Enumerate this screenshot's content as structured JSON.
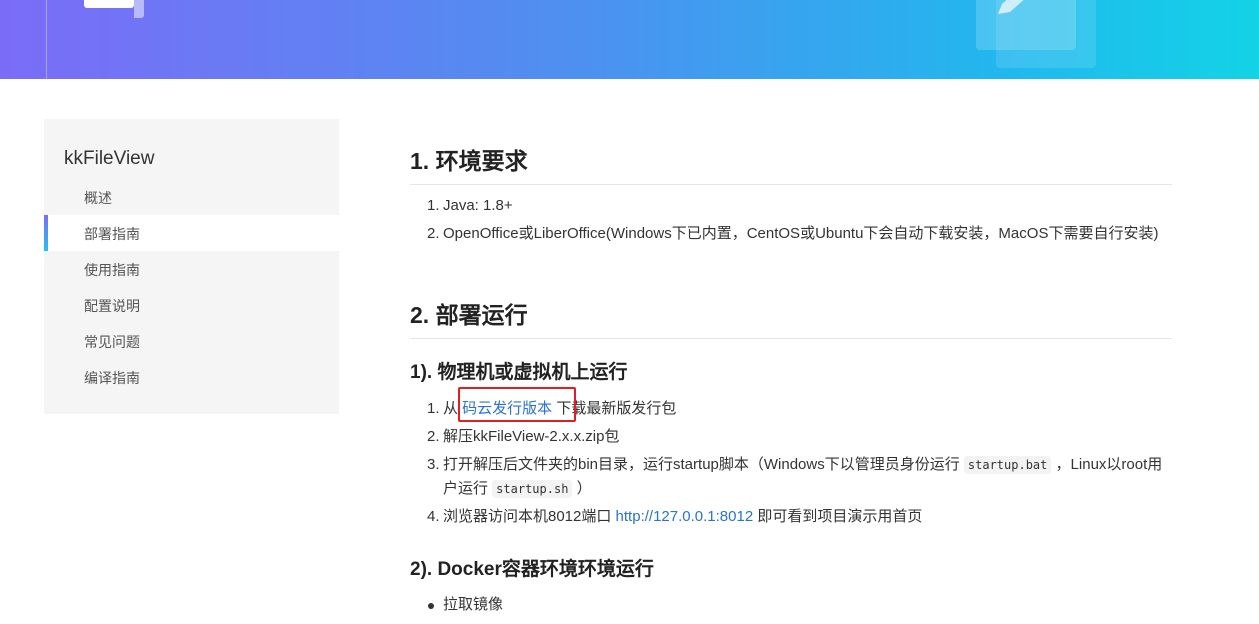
{
  "sidebar": {
    "title": "kkFileView",
    "items": [
      {
        "label": "概述"
      },
      {
        "label": "部署指南"
      },
      {
        "label": "使用指南"
      },
      {
        "label": "配置说明"
      },
      {
        "label": "常见问题"
      },
      {
        "label": "编译指南"
      }
    ]
  },
  "content": {
    "section1": {
      "heading": "1. 环境要求",
      "items": [
        {
          "num": "1.",
          "text": "Java: 1.8+"
        },
        {
          "num": "2.",
          "text": "OpenOffice或LiberOffice(Windows下已内置，CentOS或Ubuntu下会自动下载安装，MacOS下需要自行安装)"
        }
      ]
    },
    "section2": {
      "heading": "2. 部署运行",
      "sub1": {
        "heading": "1). 物理机或虚拟机上运行",
        "item1": {
          "num": "1.",
          "prefix": "从 ",
          "link": "码云发行版本",
          "suffix": " 下载最新版发行包"
        },
        "item2": {
          "num": "2.",
          "text": "解压kkFileView-2.x.x.zip包"
        },
        "item3": {
          "num": "3.",
          "part1": "打开解压后文件夹的bin目录，运行startup脚本（Windows下以管理员身份运行 ",
          "code1": "startup.bat",
          "part2": " ，Linux以root用户运行 ",
          "code2": "startup.sh",
          "part3": " ）"
        },
        "item4": {
          "num": "4.",
          "prefix": "浏览器访问本机8012端口 ",
          "link": "http://127.0.0.1:8012",
          "suffix": " 即可看到项目演示用首页"
        }
      },
      "sub2": {
        "heading": "2). Docker容器环境环境运行",
        "bullet": "拉取镜像"
      }
    }
  }
}
